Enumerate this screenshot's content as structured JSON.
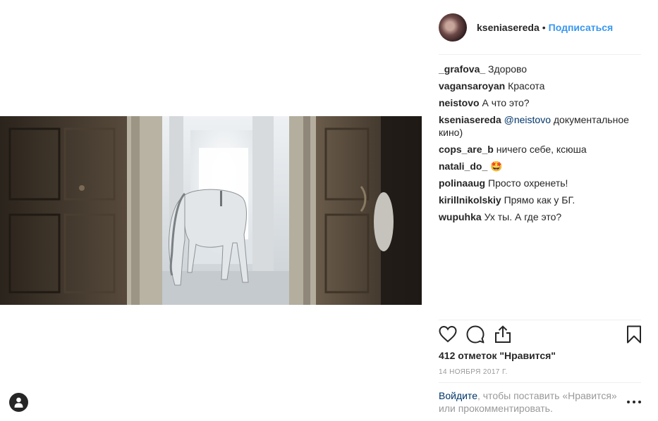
{
  "post": {
    "author": "kseniasereda",
    "separator": "•",
    "follow_label": "Подписаться",
    "likes_text": "412 отметок \"Нравится\"",
    "date": "14 ноября 2017 г."
  },
  "comments": [
    {
      "user": "_grafova_",
      "text": "Здорово"
    },
    {
      "user": "vagansaroyan",
      "text": "Красота"
    },
    {
      "user": "neistovo",
      "text": "А что это?"
    },
    {
      "user": "kseniasereda",
      "mention": "@neistovo",
      "text": "документальное кино)"
    },
    {
      "user": "cops_are_b",
      "text": "ничего себе, ксюша"
    },
    {
      "user": "natali_do_",
      "text": "🤩"
    },
    {
      "user": "polinaaug",
      "text": "Просто охренеть!"
    },
    {
      "user": "kirillnikolskiy",
      "text": "Прямо как у БГ."
    },
    {
      "user": "wupuhka",
      "text": "Ух ты. А где это?"
    }
  ],
  "footer": {
    "login_link": "Войдите",
    "login_rest": ", чтобы поставить «Нравится» или прокомментировать."
  },
  "icons": {
    "like": "heart-icon",
    "comment": "comment-bubble-icon",
    "share": "share-icon",
    "save": "bookmark-icon",
    "more": "more-dots-icon",
    "profile": "user-icon"
  },
  "colors": {
    "link": "#3897f0",
    "dark_link": "#003569",
    "muted": "#999999",
    "text": "#262626"
  }
}
